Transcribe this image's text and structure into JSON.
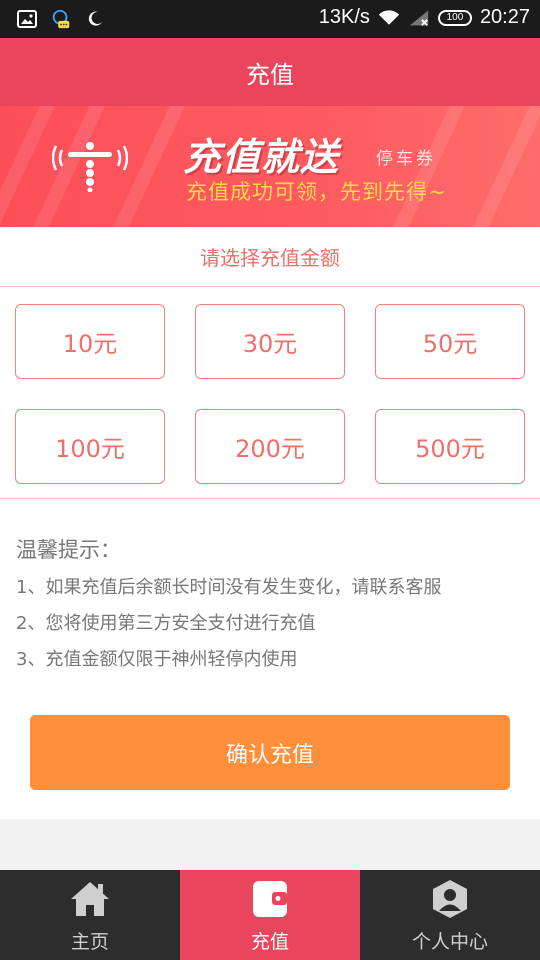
{
  "status_bar": {
    "net_speed": "13K/s",
    "battery_level": "100",
    "time": "20:27",
    "icons": [
      "image-icon",
      "chat-robot-icon",
      "moon-icon",
      "wifi-icon",
      "signal-icon",
      "battery-icon"
    ]
  },
  "header": {
    "title": "充值"
  },
  "banner": {
    "headline": "充值就送",
    "tag": "停车券",
    "slogan": "充值成功可领，先到先得~"
  },
  "amount_section": {
    "title": "请选择充值金额",
    "options": [
      "10元",
      "30元",
      "50元",
      "100元",
      "200元",
      "500元"
    ]
  },
  "tips": {
    "title": "温馨提示：",
    "items": [
      "1、如果充值后余额长时间没有发生变化，请联系客服",
      "2、您将使用第三方安全支付进行充值",
      "3、充值金额仅限于神州轻停内使用"
    ]
  },
  "confirm_button": {
    "label": "确认充值"
  },
  "bottom_nav": {
    "items": [
      {
        "label": "主页",
        "icon": "home-icon",
        "active": false
      },
      {
        "label": "充值",
        "icon": "wallet-icon",
        "active": true
      },
      {
        "label": "个人中心",
        "icon": "user-icon",
        "active": false
      }
    ]
  },
  "colors": {
    "brand": "#e9465d",
    "accent_orange": "#ff8f3a",
    "amount_border": "#f0857c",
    "banner_yellow": "#ffd84d"
  }
}
